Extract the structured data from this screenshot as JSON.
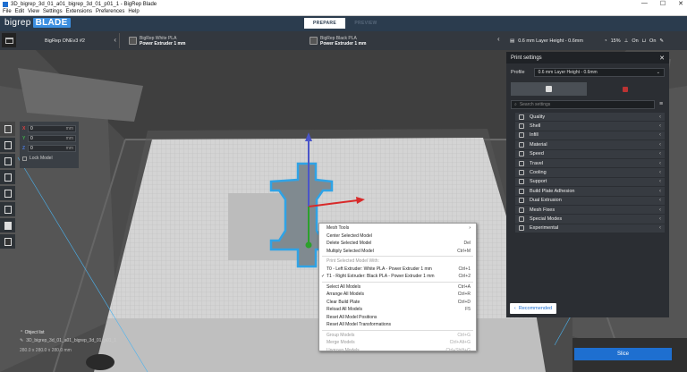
{
  "window": {
    "title": "3D_bigrep_3d_01_a01_bigrep_3d_01_p01_1 - BigRep Blade",
    "min": "—",
    "max": "☐",
    "close": "✕"
  },
  "menubar": [
    "File",
    "Edit",
    "View",
    "Settings",
    "Extensions",
    "Preferences",
    "Help"
  ],
  "logo": {
    "part1": "bigrep",
    "part2": "BLADE"
  },
  "stages": {
    "prepare": "PREPARE",
    "preview": "PREVIEW"
  },
  "printer": {
    "name": "BigRep ONEv3 #2"
  },
  "extruders": [
    {
      "name": "BigRep White PLA",
      "type": "Power Extruder 1 mm",
      "icon": "T0"
    },
    {
      "name": "BigRep Black PLA",
      "type": "Power Extruder 1 mm",
      "icon": "T1"
    }
  ],
  "profile_summary": {
    "name": "0.6 mm Layer Height - 0.6mm",
    "infill": "15%",
    "support": "On",
    "adhesion": "On"
  },
  "move": {
    "x": "0",
    "y": "0",
    "z": "0",
    "unit": "mm",
    "lock_label": "Lock Model"
  },
  "print_settings": {
    "title": "Print settings",
    "profile_label": "Profile",
    "profile_value": "0.6 mm Layer Height - 0.6mm",
    "search_placeholder": "Search settings",
    "categories": [
      "Quality",
      "Shell",
      "Infill",
      "Material",
      "Speed",
      "Travel",
      "Cooling",
      "Support",
      "Build Plate Adhesion",
      "Dual Extrusion",
      "Mesh Fixes",
      "Special Modes",
      "Experimental"
    ],
    "recommended": "Recommended"
  },
  "context_menu": {
    "mesh_tools": "Mesh Tools",
    "center": "Center Selected Model",
    "delete": "Delete Selected Model",
    "delete_sc": "Del",
    "multiply": "Multiply Selected Model",
    "multiply_sc": "Ctrl+M",
    "print_with": "Print Selected Model With:",
    "t0": "T0 - Left Extruder: White PLA - Power Extruder 1 mm",
    "t0_sc": "Ctrl+1",
    "t1": "T1 - Right Extruder: Black PLA - Power Extruder 1 mm",
    "t1_sc": "Ctrl+2",
    "select_all": "Select All Models",
    "select_all_sc": "Ctrl+A",
    "arrange_all": "Arrange All Models",
    "arrange_all_sc": "Ctrl+R",
    "clear": "Clear Build Plate",
    "clear_sc": "Ctrl+D",
    "reload": "Reload All Models",
    "reload_sc": "F5",
    "reset_pos": "Reset All Model Positions",
    "reset_trans": "Reset All Model Transformations",
    "group": "Group Models",
    "group_sc": "Ctrl+G",
    "merge": "Merge Models",
    "merge_sc": "Ctrl+Alt+G",
    "ungroup": "Ungroup Models",
    "ungroup_sc": "Ctrl+Shift+G"
  },
  "object_list": {
    "header": "Object list",
    "item": "3D_bigrep_3d_01_a01_bigrep_3d_01_p01_1",
    "dims": "280.0 x 280.0 x 280.0 mm"
  },
  "slice_label": "Slice",
  "colors": {
    "accent": "#1e6fd0",
    "header": "#2b3c4e",
    "selection": "#2fa3e6"
  }
}
